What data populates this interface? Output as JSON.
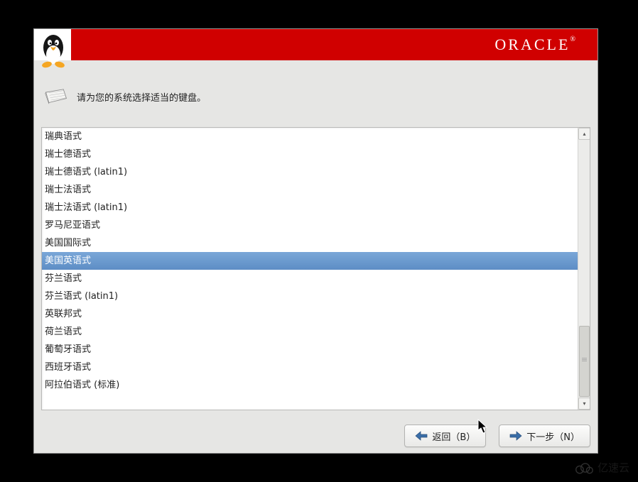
{
  "header": {
    "logo_text": "ORACLE"
  },
  "prompt": {
    "text": "请为您的系统选择适当的键盘。"
  },
  "keyboard_list": {
    "items": [
      {
        "label": "瑞典语式",
        "selected": false
      },
      {
        "label": "瑞士德语式",
        "selected": false
      },
      {
        "label": "瑞士德语式 (latin1)",
        "selected": false
      },
      {
        "label": "瑞士法语式",
        "selected": false
      },
      {
        "label": "瑞士法语式 (latin1)",
        "selected": false
      },
      {
        "label": "罗马尼亚语式",
        "selected": false
      },
      {
        "label": "美国国际式",
        "selected": false
      },
      {
        "label": "美国英语式",
        "selected": true
      },
      {
        "label": "芬兰语式",
        "selected": false
      },
      {
        "label": "芬兰语式 (latin1)",
        "selected": false
      },
      {
        "label": "英联邦式",
        "selected": false
      },
      {
        "label": "荷兰语式",
        "selected": false
      },
      {
        "label": "葡萄牙语式",
        "selected": false
      },
      {
        "label": "西班牙语式",
        "selected": false
      },
      {
        "label": "阿拉伯语式 (标准)",
        "selected": false
      }
    ]
  },
  "buttons": {
    "back_label": "返回（B）",
    "next_label": "下一步（N）"
  },
  "watermark": {
    "text": "亿速云"
  }
}
